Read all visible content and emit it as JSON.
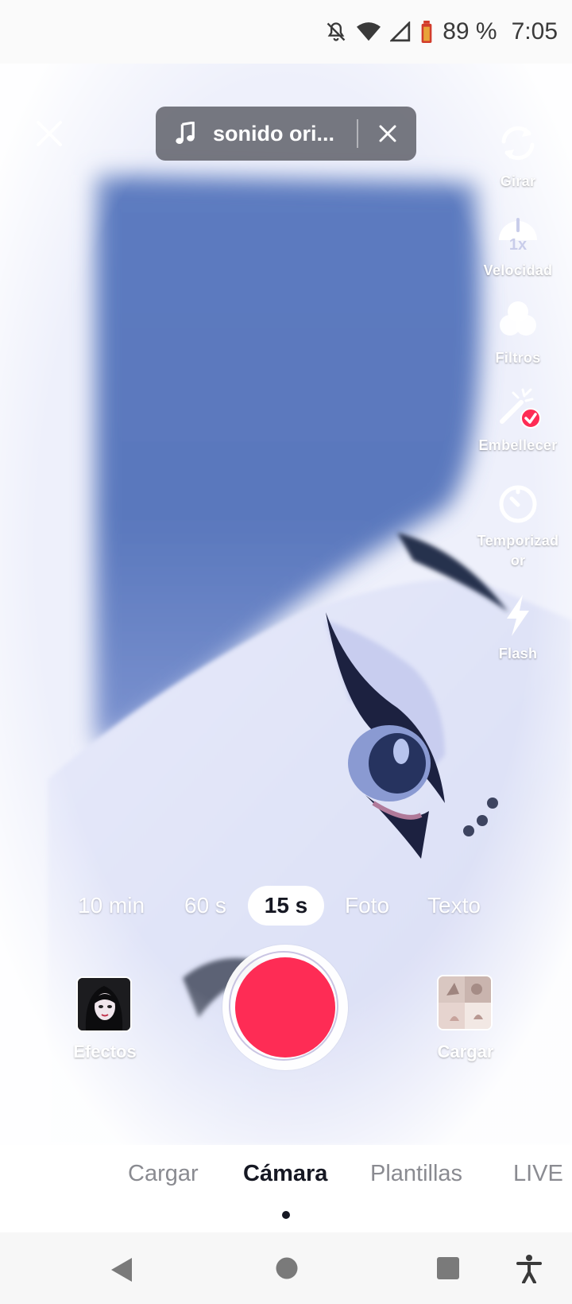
{
  "status_bar": {
    "battery": "89 %",
    "time": "7:05",
    "icons": [
      "mute-icon",
      "wifi-icon",
      "signal-icon",
      "battery-icon"
    ]
  },
  "top": {
    "close_icon": "close-icon",
    "sound": {
      "label": "sonido ori...",
      "icon": "music-note-icon",
      "remove_icon": "close-icon"
    }
  },
  "tools": [
    {
      "id": "girar",
      "label": "Girar",
      "icon": "flip-camera-icon"
    },
    {
      "id": "velocidad",
      "label": "Velocidad",
      "icon": "speed-icon",
      "value": "1x"
    },
    {
      "id": "filtros",
      "label": "Filtros",
      "icon": "filters-icon"
    },
    {
      "id": "embellecer",
      "label": "Embellecer",
      "icon": "beautify-icon",
      "active": true
    },
    {
      "id": "temporizador",
      "label": "Temporizad\nor",
      "icon": "timer-icon"
    },
    {
      "id": "flash",
      "label": "Flash",
      "icon": "flash-icon"
    }
  ],
  "durations": [
    {
      "label": "10 min",
      "selected": false
    },
    {
      "label": "60 s",
      "selected": false
    },
    {
      "label": "15 s",
      "selected": true
    },
    {
      "label": "Foto",
      "selected": false
    },
    {
      "label": "Texto",
      "selected": false
    }
  ],
  "controls": {
    "effects_label": "Efectos",
    "upload_label": "Cargar",
    "record_color": "#fe2c55"
  },
  "tabs": [
    {
      "label": "Cargar",
      "active": false
    },
    {
      "label": "Cámara",
      "active": true
    },
    {
      "label": "Plantillas",
      "active": false
    },
    {
      "label": "LIVE",
      "active": false
    }
  ],
  "navbar": [
    "back-icon",
    "home-icon",
    "recents-icon",
    "accessibility-icon"
  ],
  "colors": {
    "accent": "#fe2c55",
    "text_dark": "#161823",
    "text_muted": "#8a8b91"
  }
}
